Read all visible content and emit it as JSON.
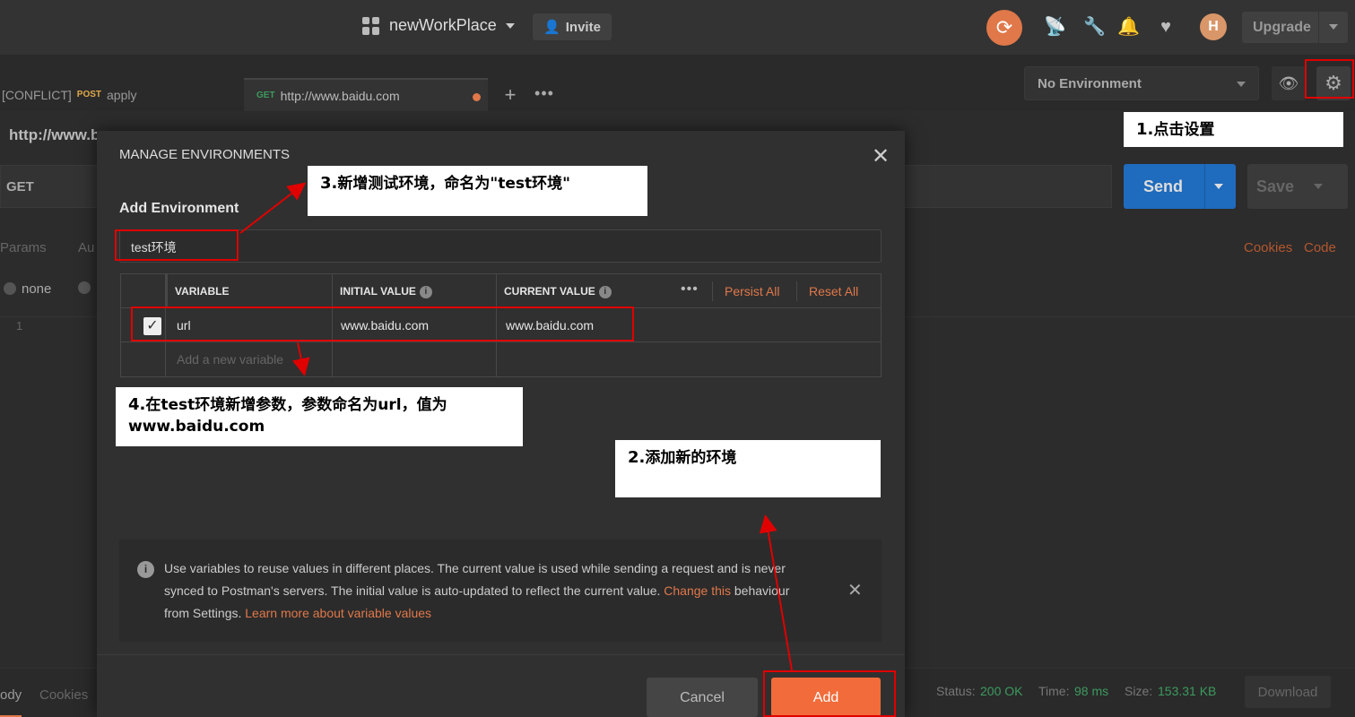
{
  "topbar": {
    "workspace_name": "newWorkPlace",
    "invite_label": "Invite",
    "upgrade_label": "Upgrade",
    "icons": [
      "sync-icon",
      "satellite-icon",
      "wrench-icon",
      "bell-icon",
      "heart-icon",
      "avatar"
    ]
  },
  "tabs": [
    {
      "prefix": "[CONFLICT]",
      "method": "POST",
      "title": "apply"
    },
    {
      "method": "GET",
      "title": "http://www.baidu.com"
    }
  ],
  "environment": {
    "selected": "No Environment"
  },
  "request": {
    "url_title": "http://www.b",
    "method": "GET",
    "send_label": "Send",
    "save_label": "Save",
    "params_label": "Params",
    "auth_label": "Au",
    "cookies_label": "Cookies",
    "code_label": "Code",
    "body_none": "none",
    "line_number": "1"
  },
  "response": {
    "body_label": "ody",
    "cookies_label": "Cookies",
    "status_label": "Status:",
    "status_value": "200 OK",
    "time_label": "Time:",
    "time_value": "98 ms",
    "size_label": "Size:",
    "size_value": "153.31 KB",
    "download_label": "Download"
  },
  "modal": {
    "title": "MANAGE ENVIRONMENTS",
    "add_env_heading": "Add Environment",
    "env_name": "test环境",
    "columns": {
      "variable": "VARIABLE",
      "initial": "INITIAL VALUE",
      "current": "CURRENT VALUE"
    },
    "persist_all": "Persist All",
    "reset_all": "Reset All",
    "rows": [
      {
        "variable": "url",
        "initial": "www.baidu.com",
        "current": "www.baidu.com",
        "checked": true
      }
    ],
    "new_variable_placeholder": "Add a new variable",
    "info_text": "Use variables to reuse values in different places. The current value is used while sending a request and is never synced to Postman's servers. The initial value is auto-updated to reflect the current value.",
    "info_link_change": "Change this",
    "info_text_2": "behaviour from Settings.",
    "info_link_learn": "Learn more about variable values",
    "cancel_label": "Cancel",
    "add_label": "Add"
  },
  "annotations": {
    "step1": {
      "num": "1.",
      "text": "点击设置"
    },
    "step2": {
      "num": "2.",
      "text": "添加新的环境"
    },
    "step3": {
      "num": "3.",
      "text": "新增测试环境，命名为\"test环境\""
    },
    "step4": {
      "num": "4.",
      "text": "在test环境新增参数，参数命名为url，值为www.baidu.com"
    }
  },
  "colors": {
    "accent": "#f26b3a",
    "send_blue": "#1f6bbd",
    "annotation_red": "#e00000"
  }
}
